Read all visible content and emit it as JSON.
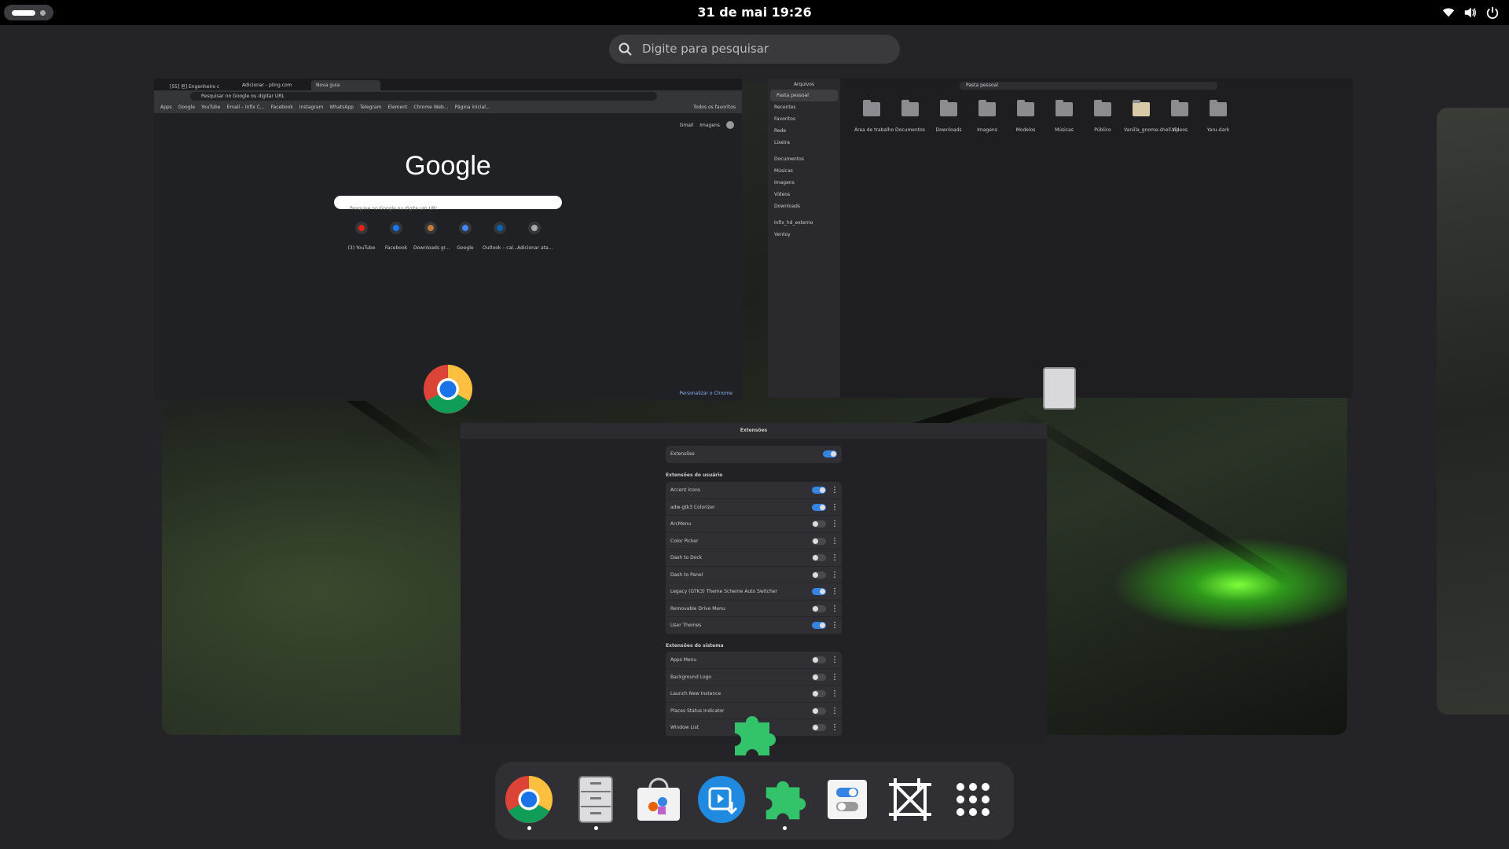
{
  "topbar": {
    "clock": "31 de mai  19:26",
    "icons": [
      "wifi-icon",
      "volume-icon",
      "power-icon"
    ]
  },
  "search": {
    "placeholder": "Digite para pesquisar"
  },
  "chrome_window": {
    "tabs": [
      "[55] 원] Engenheiro c",
      "Adicionar - pling.com",
      "Nova guia"
    ],
    "omnibox": "Pesquisar no Google ou digitar URL",
    "bookmarks": [
      "Apps",
      "Google",
      "YouTube",
      "Email – Infix C...",
      "Facebook",
      "Instagram",
      "WhatsApp",
      "Telegram",
      "Element",
      "Chrome Web...",
      "Página inicial...",
      "Todos os favoritos"
    ],
    "top_links": [
      "Gmail",
      "Imagens"
    ],
    "logo": "Google",
    "search_placeholder": "Pesquise no Google ou digite um URL",
    "shortcuts": [
      "(3) YouTube",
      "Facebook",
      "Downloads gr...",
      "Google",
      "Outlook – cal...",
      "Adicionar ata..."
    ],
    "customize": "Personalizar o Chrome"
  },
  "files_window": {
    "sidebar_title": "Arquivos",
    "path": "Pasta pessoal",
    "sidebar": [
      "Pasta pessoal",
      "Recentes",
      "Favoritos",
      "Rede",
      "Lixeira",
      "Documentos",
      "Músicas",
      "Imagens",
      "Vídeos",
      "Downloads",
      "Infix_hd_externo",
      "Ventoy"
    ],
    "folders": [
      "Área de trabalho",
      "Documentos",
      "Downloads",
      "Imagens",
      "Modelos",
      "Músicas",
      "Público",
      "Vanilla_gnome-shell.zip",
      "Vídeos",
      "Yaru-dark"
    ]
  },
  "extensions_window": {
    "title": "Extensões",
    "master_label": "Extensões",
    "master_on": true,
    "user_header": "Extensões do usuário",
    "user": [
      {
        "name": "Accent Icons",
        "on": true
      },
      {
        "name": "adw-gtk3 Colorizer",
        "on": true
      },
      {
        "name": "ArcMenu",
        "on": false
      },
      {
        "name": "Color Picker",
        "on": false
      },
      {
        "name": "Dash to Dock",
        "on": false
      },
      {
        "name": "Dash to Panel",
        "on": false
      },
      {
        "name": "Legacy (GTK3) Theme Scheme Auto Switcher",
        "on": true
      },
      {
        "name": "Removable Drive Menu",
        "on": false
      },
      {
        "name": "User Themes",
        "on": true
      }
    ],
    "system_header": "Extensões do sistema",
    "system": [
      {
        "name": "Apps Menu",
        "on": false
      },
      {
        "name": "Background Logo",
        "on": false
      },
      {
        "name": "Launch New Instance",
        "on": false
      },
      {
        "name": "Places Status Indicator",
        "on": false
      },
      {
        "name": "Window List",
        "on": false
      }
    ]
  },
  "dock": {
    "items": [
      {
        "name": "chrome-icon",
        "running": true
      },
      {
        "name": "files-icon",
        "running": true
      },
      {
        "name": "software-store-icon",
        "running": false
      },
      {
        "name": "video-downloader-icon",
        "running": false
      },
      {
        "name": "extensions-icon",
        "running": true
      },
      {
        "name": "tweaks-icon",
        "running": false
      },
      {
        "name": "screenshot-tool-icon",
        "running": false
      },
      {
        "name": "show-apps-icon",
        "running": false
      }
    ]
  },
  "colors": {
    "accent": "#3584e4",
    "extensions_green": "#33c36b"
  }
}
